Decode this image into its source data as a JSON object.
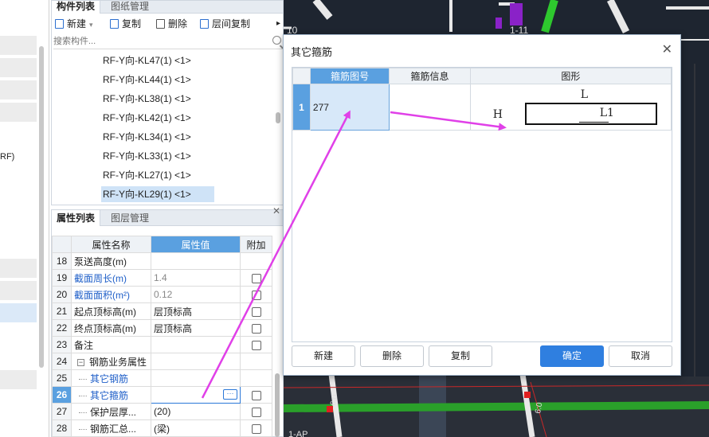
{
  "left_strip": {
    "partial_text": "RF)"
  },
  "component_panel": {
    "tabs": [
      "构件列表",
      "图纸管理"
    ],
    "toolbar": {
      "new": "新建",
      "copy": "复制",
      "delete": "删除",
      "floor_copy": "层间复制",
      "more": "▸"
    },
    "search_placeholder": "搜索构件...",
    "items": [
      "RF-Y向-KL47(1) <1>",
      "RF-Y向-KL44(1) <1>",
      "RF-Y向-KL38(1) <1>",
      "RF-Y向-KL42(1) <1>",
      "RF-Y向-KL34(1) <1>",
      "RF-Y向-KL33(1) <1>",
      "RF-Y向-KL27(1) <1>",
      "RF-Y向-KL29(1) <1>"
    ],
    "selected_index": 7
  },
  "property_panel": {
    "tabs": [
      "属性列表",
      "图层管理"
    ],
    "headers": {
      "name": "属性名称",
      "value": "属性值",
      "attach": "附加"
    },
    "rows": [
      {
        "num": "18",
        "name": "泵送高度(m)",
        "value": "",
        "blue": false,
        "grey": false,
        "checkbox": false
      },
      {
        "num": "19",
        "name": "截面周长(m)",
        "value": "1.4",
        "blue": true,
        "grey": true,
        "checkbox": true
      },
      {
        "num": "20",
        "name": "截面面积(m²)",
        "value": "0.12",
        "blue": true,
        "grey": true,
        "checkbox": true
      },
      {
        "num": "21",
        "name": "起点顶标高(m)",
        "value": "层顶标高",
        "blue": false,
        "grey": false,
        "checkbox": true
      },
      {
        "num": "22",
        "name": "终点顶标高(m)",
        "value": "层顶标高",
        "blue": false,
        "grey": false,
        "checkbox": true
      },
      {
        "num": "23",
        "name": "备注",
        "value": "",
        "blue": false,
        "grey": false,
        "checkbox": true
      },
      {
        "num": "24",
        "name": "钢筋业务属性",
        "value": "",
        "blue": false,
        "grey": false,
        "checkbox": false,
        "group": true
      },
      {
        "num": "25",
        "name": "其它钢筋",
        "value": "",
        "blue": true,
        "grey": false,
        "checkbox": false,
        "child": true
      },
      {
        "num": "26",
        "name": "其它箍筋",
        "value": "",
        "blue": true,
        "grey": false,
        "checkbox": true,
        "child": true,
        "editing": true
      },
      {
        "num": "27",
        "name": "保护层厚...",
        "value": "(20)",
        "blue": false,
        "grey": false,
        "checkbox": true,
        "child": true
      },
      {
        "num": "28",
        "name": "钢筋汇总...",
        "value": "(梁)",
        "blue": false,
        "grey": false,
        "checkbox": true,
        "child": true
      }
    ],
    "ellipsis": "···"
  },
  "dialog": {
    "title": "其它箍筋",
    "columns": {
      "code": "箍筋图号",
      "info": "箍筋信息",
      "shape": "图形"
    },
    "rows": [
      {
        "num": "1",
        "code": "277",
        "info": "",
        "shape": {
          "L": "L",
          "H": "H",
          "L1": "L1"
        }
      }
    ],
    "buttons": {
      "new": "新建",
      "delete": "删除",
      "copy": "复制",
      "ok": "确定",
      "cancel": "取消"
    }
  },
  "cad_labels": {
    "top_left": "10",
    "top_mid": "1-11",
    "bottom_a": "6:0",
    "bottom_b": "6:0",
    "bottom_left": "1-AP"
  },
  "colors": {
    "accent": "#2f7fe0",
    "header_blue": "#5aa0e0",
    "annotation": "#e040e8",
    "cad_bg": "#1e2530"
  }
}
